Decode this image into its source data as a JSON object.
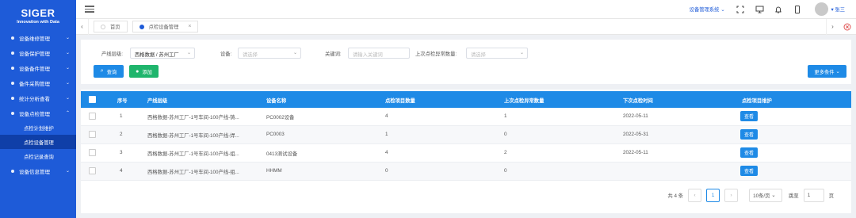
{
  "brand": {
    "name": "SIGER",
    "tagline": "Innovation with Data"
  },
  "sidebar": {
    "items": [
      {
        "label": "设备维修管理"
      },
      {
        "label": "设备保护管理"
      },
      {
        "label": "设备备件管理"
      },
      {
        "label": "备件采购管理"
      },
      {
        "label": "统计分析查看"
      },
      {
        "label": "设备点检管理"
      }
    ],
    "subitems": [
      {
        "label": "点检计划维护"
      },
      {
        "label": "点检设备管理"
      },
      {
        "label": "点检记录查询"
      }
    ],
    "last": {
      "label": "设备信息管理"
    }
  },
  "header": {
    "system_select": "设备管理系统",
    "user": "张三"
  },
  "tabs": [
    {
      "label": "首页"
    },
    {
      "label": "点检设备管理"
    }
  ],
  "filters": {
    "line_label": "产线层级:",
    "line_value": "西格数据 / 苏州工厂",
    "device_label": "设备:",
    "device_placeholder": "请选择",
    "keyword_label": "关键词:",
    "keyword_placeholder": "请输入关键词",
    "abnormal_label": "上次点检异常数量:",
    "abnormal_placeholder": "请选择",
    "query": "查询",
    "add": "添加",
    "more": "更多条件"
  },
  "table": {
    "headers": [
      "序号",
      "产线层级",
      "设备名称",
      "点检项目数量",
      "上次点检异常数量",
      "下次点检时间",
      "点检项目维护"
    ],
    "rows": [
      {
        "no": "1",
        "line": "西格数据-苏州工厂-1号车间-100产线-铸...",
        "device": "PC0002设备",
        "items": "4",
        "abnormal": "1",
        "next": "2022-05-11",
        "action": "查看"
      },
      {
        "no": "2",
        "line": "西格数据-苏州工厂-1号车间-100产线-焊...",
        "device": "PC0003",
        "items": "1",
        "abnormal": "0",
        "next": "2022-05-31",
        "action": "查看"
      },
      {
        "no": "3",
        "line": "西格数据-苏州工厂-1号车间-100产线-组...",
        "device": "0413测试设备",
        "items": "4",
        "abnormal": "2",
        "next": "2022-05-11",
        "action": "查看"
      },
      {
        "no": "4",
        "line": "西格数据-苏州工厂-1号车间-100产线-组...",
        "device": "HHMM",
        "items": "0",
        "abnormal": "0",
        "next": "",
        "action": "查看"
      }
    ]
  },
  "pagination": {
    "total": "共 4 条",
    "current": "1",
    "page_size": "10条/页",
    "goto": "跳至",
    "goto_value": "1",
    "unit": "页"
  },
  "colors": {
    "sidebar": "#1e5bd8",
    "primary": "#1e8ae6",
    "success": "#1fb56c"
  }
}
